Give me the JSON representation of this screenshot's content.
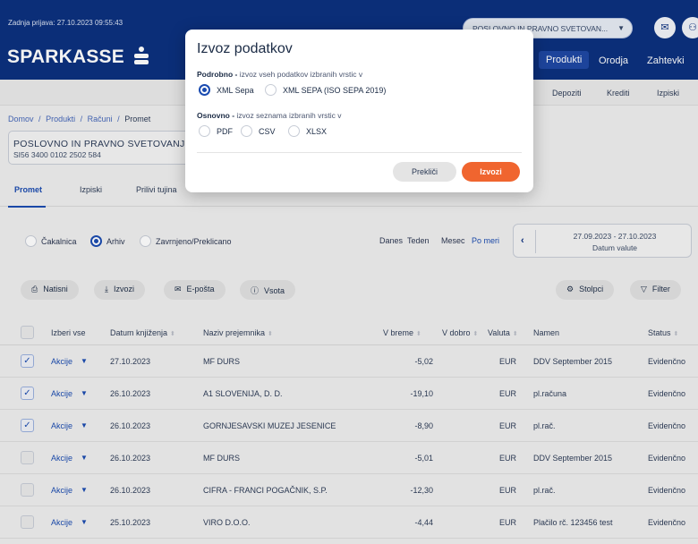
{
  "header": {
    "last_login": "Zadnja prijava: 27.10.2023 09:55:43",
    "account_select": "POSLOVNO IN PRAVNO SVETOVAN...",
    "logo_text": "SPARKASSE",
    "nav": [
      "Produkti",
      "Orodja",
      "Zahtevki"
    ]
  },
  "subnav": [
    "Depoziti",
    "Krediti",
    "Izpiski"
  ],
  "breadcrumb": [
    "Domov",
    "/",
    "Produkti",
    "/",
    "Računi",
    "/",
    "Promet"
  ],
  "account": {
    "name": "POSLOVNO IN PRAVNO SVETOVANJE D",
    "iban": "SI56 3400 0102 2502 584"
  },
  "tabs": [
    "Promet",
    "Izpiski",
    "Prilivi tujina"
  ],
  "filters": {
    "status_options": [
      "Čakalnica",
      "Arhiv",
      "Zavrnjeno/Preklicano"
    ],
    "status_selected": "Arhiv",
    "periods": [
      "Danes",
      "Teden",
      "Mesec",
      "Po meri"
    ],
    "period_selected": "Po meri",
    "date_range": "27.09.2023 - 27.10.2023",
    "date_label": "Datum valute"
  },
  "actions": {
    "print": "Natisni",
    "export": "Izvozi",
    "email": "E-pošta",
    "sum": "Vsota",
    "columns": "Stolpci",
    "filter": "Filter"
  },
  "table": {
    "headers": {
      "select_all": "Izberi vse",
      "date": "Datum knjiženja",
      "recipient": "Naziv prejemnika",
      "debit": "V breme",
      "credit": "V dobro",
      "currency": "Valuta",
      "purpose": "Namen",
      "status": "Status"
    },
    "rows": [
      {
        "checked": true,
        "action": "Akcije",
        "date": "27.10.2023",
        "recipient": "MF DURS",
        "debit": "-5,02",
        "currency": "EUR",
        "purpose": "DDV September 2015",
        "status": "Evidenčno"
      },
      {
        "checked": true,
        "action": "Akcije",
        "date": "26.10.2023",
        "recipient": "A1 SLOVENIJA, D. D.",
        "debit": "-19,10",
        "currency": "EUR",
        "purpose": "pl.računa",
        "status": "Evidenčno"
      },
      {
        "checked": true,
        "action": "Akcije",
        "date": "26.10.2023",
        "recipient": "GORNJESAVSKI MUZEJ JESENICE",
        "debit": "-8,90",
        "currency": "EUR",
        "purpose": "pl.rač.",
        "status": "Evidenčno"
      },
      {
        "checked": false,
        "action": "Akcije",
        "date": "26.10.2023",
        "recipient": "MF DURS",
        "debit": "-5,01",
        "currency": "EUR",
        "purpose": "DDV September 2015",
        "status": "Evidenčno"
      },
      {
        "checked": false,
        "action": "Akcije",
        "date": "26.10.2023",
        "recipient": "CIFRA - FRANCI POGAČNIK, S.P.",
        "debit": "-12,30",
        "currency": "EUR",
        "purpose": "pl.rač.",
        "status": "Evidenčno"
      },
      {
        "checked": false,
        "action": "Akcije",
        "date": "25.10.2023",
        "recipient": "VIRO D.O.O.",
        "debit": "-4,44",
        "currency": "EUR",
        "purpose": "Plačilo rč. 123456 test",
        "status": "Evidenčno"
      }
    ]
  },
  "modal": {
    "title": "Izvoz podatkov",
    "detailed_bold": "Podrobno -",
    "detailed_desc": " izvoz vseh podatkov izbranih vrstic v",
    "detailed_options": [
      "XML Sepa",
      "XML SEPA (ISO SEPA 2019)"
    ],
    "detailed_selected": "XML Sepa",
    "basic_bold": "Osnovno -",
    "basic_desc": " izvoz seznama izbranih vrstic v",
    "basic_options": [
      "PDF",
      "CSV",
      "XLSX"
    ],
    "cancel": "Prekliči",
    "confirm": "Izvozi"
  },
  "colors": {
    "brand_navy": "#0a2f7e",
    "accent_blue": "#1a4bb0",
    "export_orange": "#f0652f"
  }
}
